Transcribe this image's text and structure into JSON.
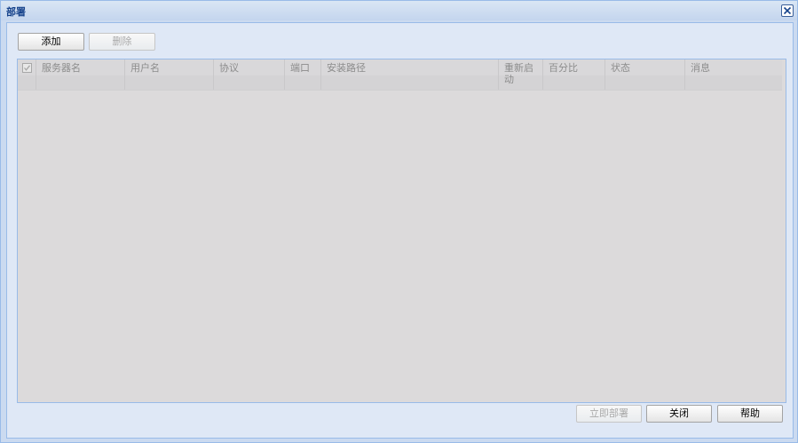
{
  "window": {
    "title": "部署"
  },
  "toolbar": {
    "add_label": "添加",
    "delete_label": "删除"
  },
  "grid": {
    "columns": [
      {
        "key": "select",
        "label": ""
      },
      {
        "key": "server",
        "label": "服务器名"
      },
      {
        "key": "user",
        "label": "用户名"
      },
      {
        "key": "protocol",
        "label": "协议"
      },
      {
        "key": "port",
        "label": "端口"
      },
      {
        "key": "path",
        "label": "安装路径"
      },
      {
        "key": "restart",
        "label": "重新启动"
      },
      {
        "key": "percent",
        "label": "百分比"
      },
      {
        "key": "status",
        "label": "状态"
      },
      {
        "key": "message",
        "label": "消息"
      }
    ],
    "rows": []
  },
  "footer": {
    "deploy_label": "立即部署",
    "close_label": "关闭",
    "help_label": "帮助"
  },
  "icons": {
    "close": "close-icon",
    "checkbox": "checkmark-icon"
  }
}
